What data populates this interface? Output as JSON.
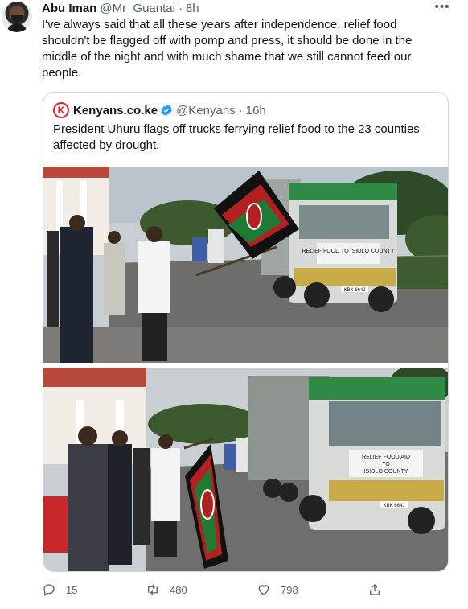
{
  "tweet": {
    "author_name": "Abu Iman",
    "author_handle": "@Mr_Guantai",
    "separator": "·",
    "time": "8h",
    "more_label": "•••",
    "text": "I've always said that all these years after independence, relief food shouldn't be flagged off with pomp and press, it should be done in the middle of the night and with much shame that we still cannot feed our people."
  },
  "quoted": {
    "logo_letter": "K",
    "author_name": "Kenyans.co.ke",
    "author_handle": "@Kenyans",
    "separator": "·",
    "time": "16h",
    "text": "President Uhuru flags off trucks ferrying relief food to the 23 counties affected by drought.",
    "photo1_truck_sign": "RELIEF FOOD TO ISIOLO COUNTY",
    "photo1_plate": "KBK 664J",
    "photo2_truck_sign_line1": "RELIEF FOOD AID",
    "photo2_truck_sign_line2": "TO",
    "photo2_truck_sign_line3": "ISIOLO COUNTY",
    "photo2_plate": "KBK 664J"
  },
  "actions": {
    "replies": "15",
    "retweets": "480",
    "likes": "798"
  },
  "colors": {
    "text": "#0f1419",
    "secondary": "#536471",
    "border": "#cfd9de",
    "verified": "#1d9bf0"
  },
  "icons": [
    "more-icon",
    "verified-icon",
    "reply-icon",
    "retweet-icon",
    "like-icon",
    "share-icon"
  ]
}
